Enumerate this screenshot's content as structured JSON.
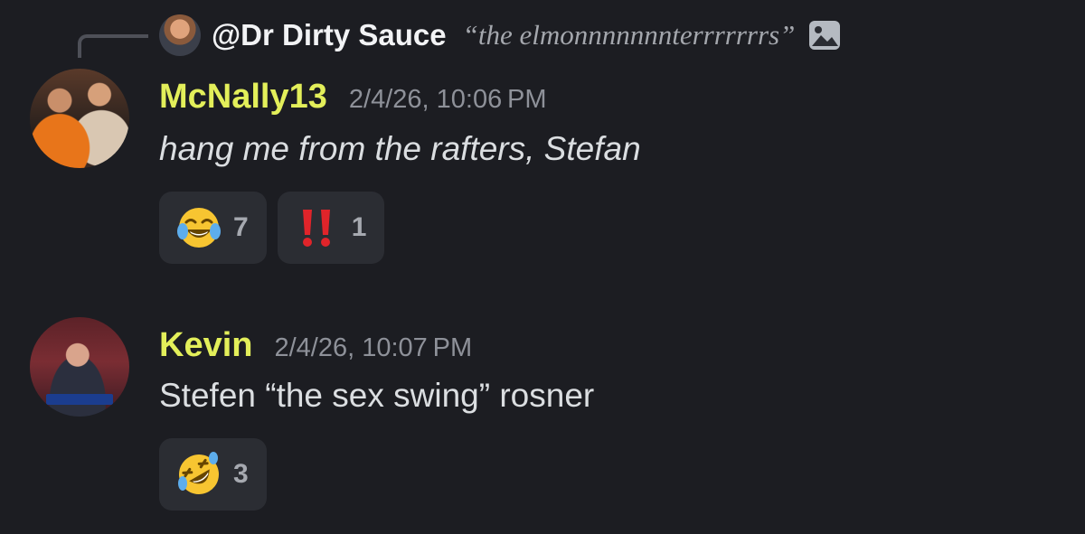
{
  "reply": {
    "author": "@Dr Dirty Sauce",
    "text": "“the elmonnnnnnnterrrrrrrs”",
    "attachment_icon": "image-icon"
  },
  "messages": [
    {
      "username": "McNally13",
      "timestamp": "2/4/26, 10:06 PM",
      "content": "hang me from the rafters, Stefan",
      "reactions": [
        {
          "emoji": "face-with-tears-of-joy",
          "count": "7"
        },
        {
          "emoji": "double-exclamation-mark",
          "count": "1"
        }
      ]
    },
    {
      "username": "Kevin",
      "timestamp": "2/4/26, 10:07 PM",
      "content": "Stefen “the sex swing” rosner",
      "reactions": [
        {
          "emoji": "rolling-on-the-floor-laughing",
          "count": "3"
        }
      ]
    }
  ],
  "colors": {
    "background": "#1c1d22",
    "username": "#e3ef5a",
    "timestamp": "#8e9199",
    "reaction_bg": "#2b2d33"
  }
}
